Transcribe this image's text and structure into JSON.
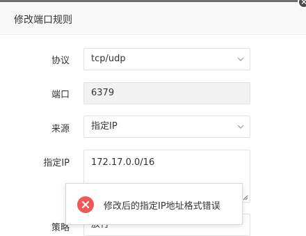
{
  "dialog": {
    "title": "修改端口规则",
    "close_icon": "close-icon"
  },
  "form": {
    "protocol": {
      "label": "协议",
      "value": "tcp/udp"
    },
    "port": {
      "label": "端口",
      "value": "6379"
    },
    "source": {
      "label": "来源",
      "value": "指定IP"
    },
    "specified_ip": {
      "label": "指定IP",
      "value": "172.17.0.0/16"
    },
    "strategy": {
      "label": "策略",
      "value": "放行"
    }
  },
  "toast": {
    "message": "修改后的指定IP地址格式错误",
    "icon": "error-icon",
    "color": "#f05757"
  }
}
